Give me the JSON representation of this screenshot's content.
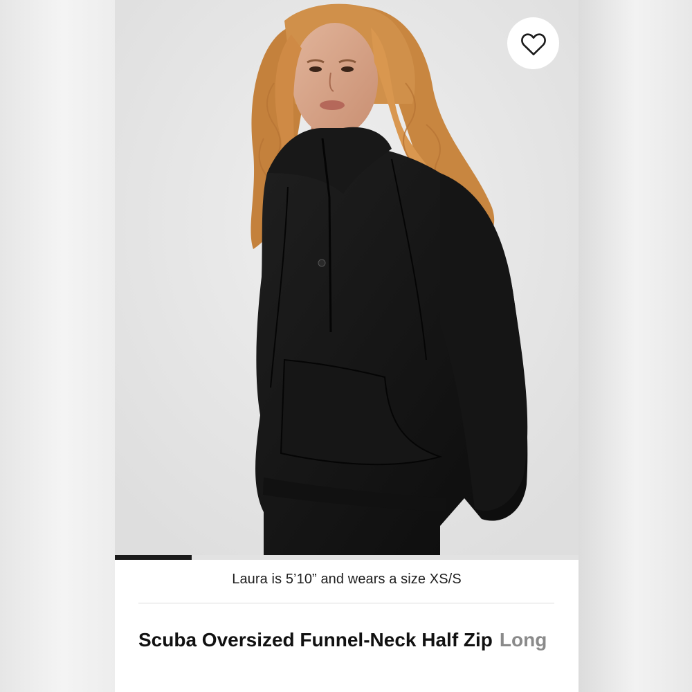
{
  "hero": {
    "image_alt": "Model with long curly copper hair wearing a black oversized funnel-neck half zip sweatshirt",
    "product_color": "#141414",
    "hair_color": "#c9853f",
    "background_color": "#e6e6e6"
  },
  "wishlist": {
    "icon": "heart-outline-icon"
  },
  "gallery": {
    "progress": 0.166
  },
  "caption": "Laura is 5’10” and wears a size XS/S",
  "product": {
    "name": "Scuba Oversized Funnel-Neck Half Zip",
    "variant": "Long"
  }
}
